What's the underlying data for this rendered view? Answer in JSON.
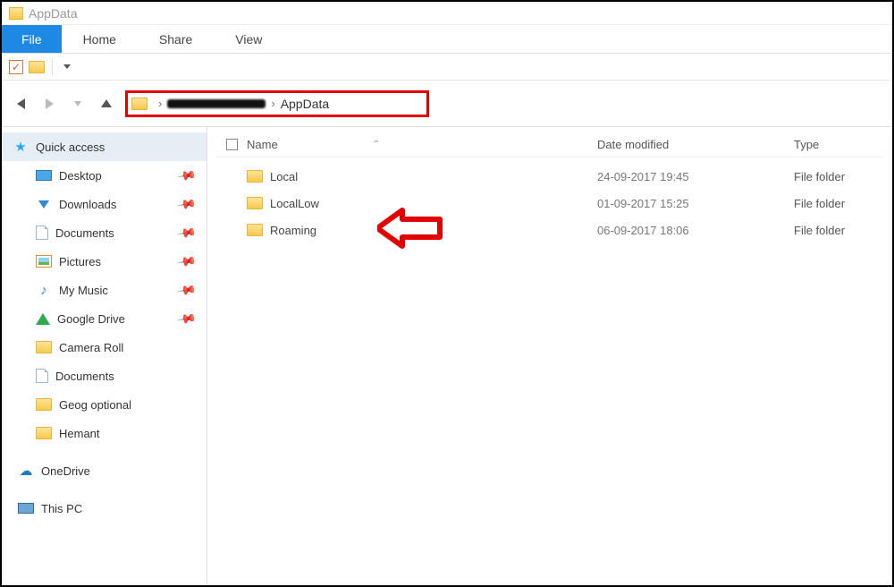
{
  "window": {
    "title": "AppData"
  },
  "ribbon": {
    "file": "File",
    "home": "Home",
    "share": "Share",
    "view": "View"
  },
  "breadcrumb": {
    "current": "AppData",
    "separator": "›"
  },
  "columns": {
    "name": "Name",
    "date": "Date modified",
    "type": "Type"
  },
  "rows": [
    {
      "name": "Local",
      "date": "24-09-2017 19:45",
      "type": "File folder"
    },
    {
      "name": "LocalLow",
      "date": "01-09-2017 15:25",
      "type": "File folder"
    },
    {
      "name": "Roaming",
      "date": "06-09-2017 18:06",
      "type": "File folder"
    }
  ],
  "sidebar": {
    "quick_access": "Quick access",
    "items": [
      {
        "label": "Desktop",
        "pinned": true,
        "icon": "desktop"
      },
      {
        "label": "Downloads",
        "pinned": true,
        "icon": "downloads"
      },
      {
        "label": "Documents",
        "pinned": true,
        "icon": "doc"
      },
      {
        "label": "Pictures",
        "pinned": true,
        "icon": "pic"
      },
      {
        "label": "My Music",
        "pinned": true,
        "icon": "music"
      },
      {
        "label": "Google Drive",
        "pinned": true,
        "icon": "gdrive"
      },
      {
        "label": "Camera Roll",
        "pinned": false,
        "icon": "folder"
      },
      {
        "label": "Documents",
        "pinned": false,
        "icon": "doc"
      },
      {
        "label": "Geog optional",
        "pinned": false,
        "icon": "folder"
      },
      {
        "label": "Hemant",
        "pinned": false,
        "icon": "folder"
      }
    ],
    "onedrive": "OneDrive",
    "thispc": "This PC"
  },
  "annotation": {
    "highlight_color": "#e20000"
  }
}
